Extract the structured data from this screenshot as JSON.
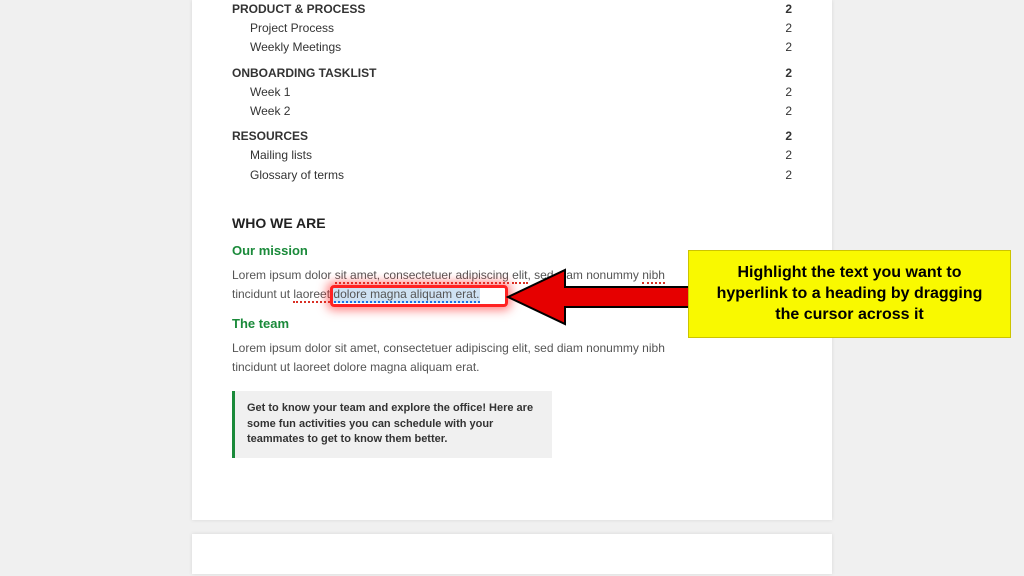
{
  "toc": [
    {
      "label": "PRODUCT & PROCESS",
      "page": "2",
      "level": 1
    },
    {
      "label": "Project Process",
      "page": "2",
      "level": 2
    },
    {
      "label": "Weekly Meetings",
      "page": "2",
      "level": 2
    },
    {
      "label": "ONBOARDING TASKLIST",
      "page": "2",
      "level": 1
    },
    {
      "label": "Week 1",
      "page": "2",
      "level": 2
    },
    {
      "label": "Week 2",
      "page": "2",
      "level": 2
    },
    {
      "label": "RESOURCES",
      "page": "2",
      "level": 1
    },
    {
      "label": "Mailing lists",
      "page": "2",
      "level": 2
    },
    {
      "label": "Glossary of terms",
      "page": "2",
      "level": 2
    }
  ],
  "section_title": "WHO WE ARE",
  "mission": {
    "heading": "Our mission",
    "line1_a": "Lorem ipsum dolor ",
    "line1_b": "sit amet, consectetuer adipiscing",
    "line1_c": " ",
    "line1_d": "elit",
    "line1_e": ", se",
    "line1_f": "d",
    "line1_g": " diam nonummy ",
    "line1_h": "nibh",
    "line2_a": "tincidunt ut ",
    "line2_b": "laoreet",
    "selected_text": " dolore magna aliquam erat.",
    "period": ""
  },
  "team": {
    "heading": "The team",
    "line1": "Lorem ipsum dolor sit amet, consectetuer adipiscing elit, sed diam nonummy nibh",
    "line2": "tincidunt ut laoreet dolore magna aliquam erat."
  },
  "tip": "Get to know your team and explore the office! Here are some fun activities you can schedule with your teammates to get to know them better.",
  "callout_text": "Highlight the text you want to hyperlink to a heading by dragging the cursor across it"
}
